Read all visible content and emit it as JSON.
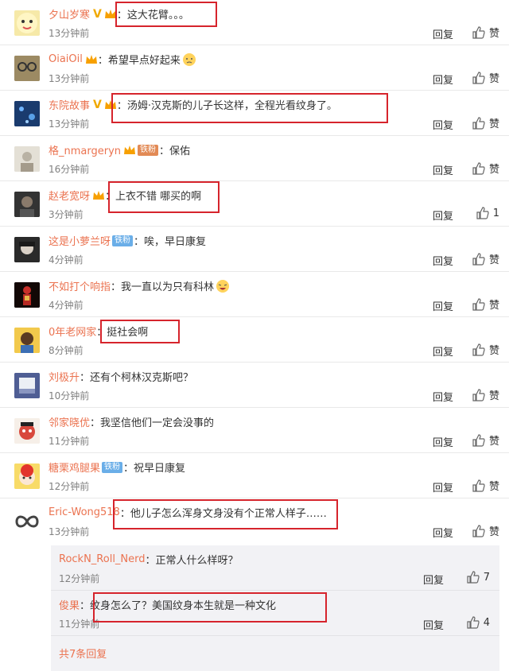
{
  "actions": {
    "reply": "回复",
    "like": "赞"
  },
  "comments": [
    {
      "user": "夕山岁寒",
      "sep": "：",
      "text": "这大花臂。。。",
      "time": "13分钟前",
      "likes": ""
    },
    {
      "user": "OiaiOil",
      "sep": "：",
      "text": "希望早点好起来",
      "time": "13分钟前",
      "likes": ""
    },
    {
      "user": "东院故事",
      "sep": "：",
      "text": "汤姆·汉克斯的儿子长这样，全程光看纹身了。",
      "time": "13分钟前",
      "likes": ""
    },
    {
      "user": "格_nmargeryn",
      "badge": "铁粉",
      "sep": "：",
      "text": "保佑",
      "time": "16分钟前",
      "likes": ""
    },
    {
      "user": "赵老宽呀",
      "sep": "：",
      "text": "上衣不错 哪买的啊",
      "time": "3分钟前",
      "likes": "1"
    },
    {
      "user": "这是小萝兰呀",
      "badge": "铁粉",
      "sep": "：",
      "text": "唉，早日康复",
      "time": "4分钟前",
      "likes": ""
    },
    {
      "user": "不如打个响指",
      "sep": "：",
      "text": "我一直以为只有科林",
      "time": "4分钟前",
      "likes": ""
    },
    {
      "user": "0年老网家",
      "sep": "：",
      "text": "挺社会啊",
      "time": "8分钟前",
      "likes": ""
    },
    {
      "user": "刘极升",
      "sep": "：",
      "text": "还有个柯林汉克斯吧？",
      "time": "10分钟前",
      "likes": ""
    },
    {
      "user": "邻家晓优",
      "sep": "：",
      "text": "我坚信他们一定会没事的",
      "time": "11分钟前",
      "likes": ""
    },
    {
      "user": "糖栗鸡腿果",
      "badge": "铁粉",
      "sep": "：",
      "text": "祝早日康复",
      "time": "12分钟前",
      "likes": ""
    },
    {
      "user": "Eric-Wong518",
      "sep": "：",
      "text": "他儿子怎么浑身文身没有个正常人样子……",
      "time": "13分钟前",
      "likes": ""
    }
  ],
  "sub_replies": [
    {
      "user": "RockN_Roll_Nerd",
      "sep": "：",
      "text": "正常人什么样呀？",
      "time": "12分钟前",
      "likes": "7"
    },
    {
      "user": "俊果",
      "sep": "：",
      "text": "纹身怎么了？美国纹身本生就是一种文化",
      "time": "11分钟前",
      "likes": "4"
    }
  ],
  "more_replies": "共7条回复",
  "colors": {
    "username": "#eb7350",
    "highlight": "#d6242c",
    "badge_iron": "#6aaee8",
    "badge_fan": "#e28a55"
  }
}
